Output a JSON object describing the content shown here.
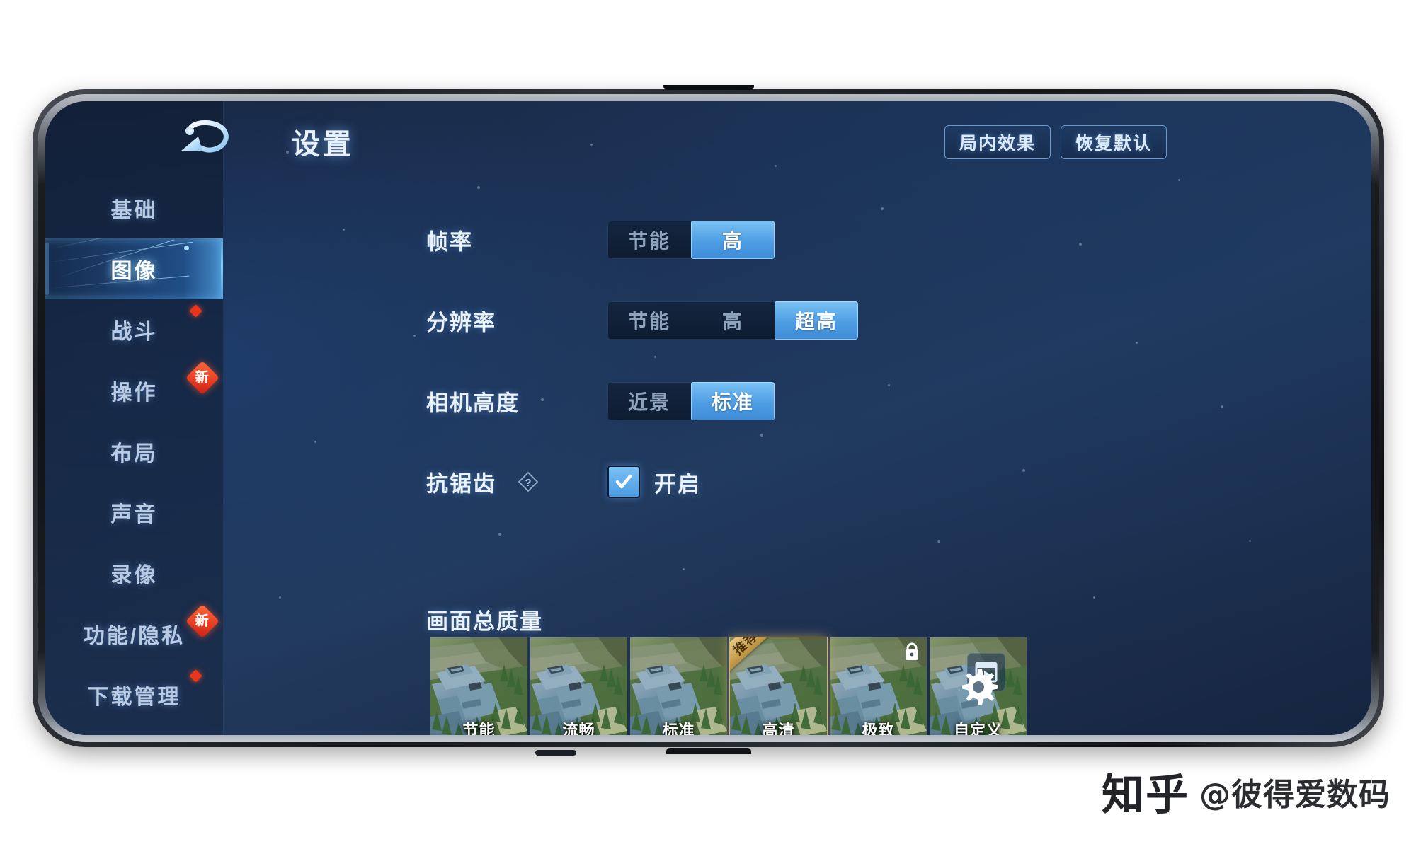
{
  "header": {
    "title": "设置",
    "back_icon": "back-arrow-icon",
    "buttons": [
      {
        "id": "ingame-effects",
        "label": "局内效果"
      },
      {
        "id": "restore-default",
        "label": "恢复默认"
      }
    ]
  },
  "sidebar": {
    "items": [
      {
        "label": "基础",
        "active": false,
        "badge": null
      },
      {
        "label": "图像",
        "active": true,
        "badge": null
      },
      {
        "label": "战斗",
        "active": false,
        "badge": "dot"
      },
      {
        "label": "操作",
        "active": false,
        "badge": "新"
      },
      {
        "label": "布局",
        "active": false,
        "badge": null
      },
      {
        "label": "声音",
        "active": false,
        "badge": null
      },
      {
        "label": "录像",
        "active": false,
        "badge": null
      },
      {
        "label": "功能/隐私",
        "active": false,
        "badge": "新"
      },
      {
        "label": "下载管理",
        "active": false,
        "badge": "dot"
      }
    ]
  },
  "settings": {
    "rows": [
      {
        "id": "frame-rate",
        "label": "帧率",
        "control": "segmented",
        "options": [
          "节能",
          "高"
        ],
        "selected": "高"
      },
      {
        "id": "resolution",
        "label": "分辨率",
        "control": "segmented",
        "options": [
          "节能",
          "高",
          "超高"
        ],
        "selected": "超高"
      },
      {
        "id": "camera-height",
        "label": "相机高度",
        "control": "segmented",
        "options": [
          "近景",
          "标准"
        ],
        "selected": "标准"
      },
      {
        "id": "anti-aliasing",
        "label": "抗锯齿",
        "control": "checkbox",
        "help_icon": "help-diamond-icon",
        "checkbox_label": "开启",
        "checked": true
      }
    ]
  },
  "quality": {
    "title": "画面总质量",
    "tiles": [
      {
        "label": "节能",
        "selected": false,
        "ribbon": null,
        "icon": null
      },
      {
        "label": "流畅",
        "selected": false,
        "ribbon": null,
        "icon": null
      },
      {
        "label": "标准",
        "selected": false,
        "ribbon": null,
        "icon": null
      },
      {
        "label": "高清",
        "selected": true,
        "ribbon": "推荐",
        "icon": null
      },
      {
        "label": "极致",
        "selected": false,
        "ribbon": null,
        "icon": "lock-icon"
      },
      {
        "label": "自定义",
        "selected": false,
        "ribbon": null,
        "icon": "gear-icon"
      }
    ],
    "preview_button_icon": "video-preview-icon"
  },
  "watermark": {
    "logo": "知乎",
    "handle": "@彼得爱数码"
  },
  "colors": {
    "accent": "#4e9ee4",
    "accent_light": "#7bc2f5",
    "panel_bg": "#1d3152",
    "badge_red": "#e8351b",
    "selected_gold": "#d8b46a",
    "text_primary": "#eaf2fb",
    "text_muted": "#8ea4bd"
  }
}
